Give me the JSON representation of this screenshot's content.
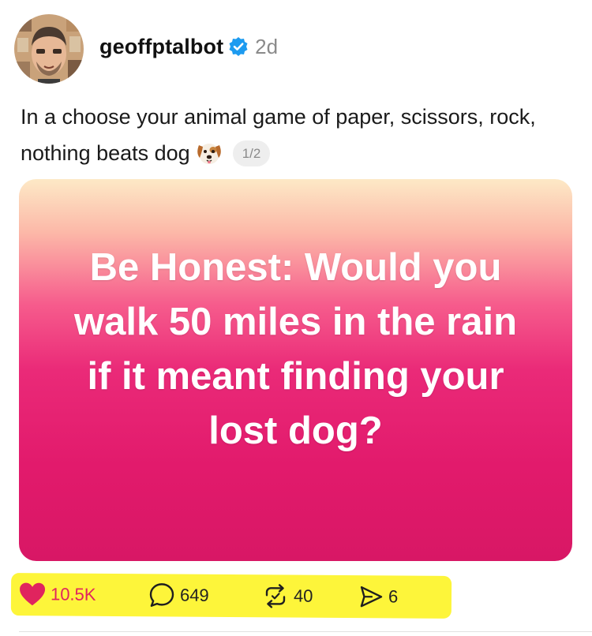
{
  "post": {
    "username": "geoffptalbot",
    "timestamp": "2d",
    "caption": "In a choose your animal game of paper, scissors, rock, nothing beats dog",
    "caption_emoji": "dog-face-emoji",
    "page_indicator": "1/2",
    "verified": true
  },
  "media": {
    "text": "Be Honest: Would you walk 50 miles in the rain if it meant finding your lost dog?"
  },
  "actions": {
    "like_count": "10.5K",
    "comment_count": "649",
    "repost_count": "40",
    "share_count": "6",
    "liked": true
  },
  "colors": {
    "verified_blue": "#1d9bf0",
    "like_red": "#e0245e",
    "highlight_yellow": "#fdf53a",
    "media_gradient_top": "#fde9c6",
    "media_gradient_bottom": "#d81765"
  },
  "icons": [
    "avatar",
    "verified-badge-icon",
    "dog-face-emoji",
    "heart-icon",
    "comment-icon",
    "repost-icon",
    "share-icon"
  ]
}
